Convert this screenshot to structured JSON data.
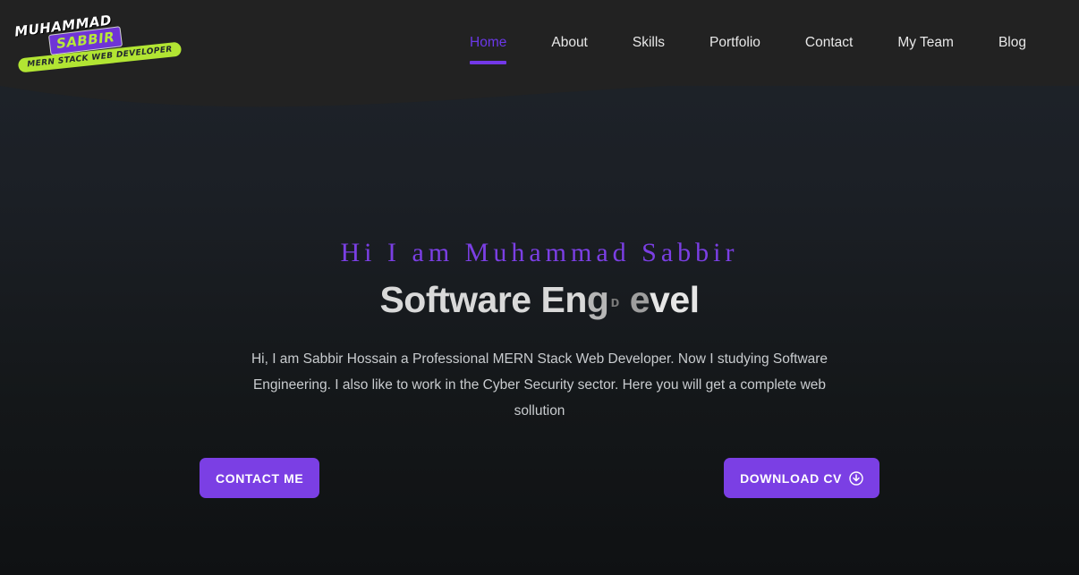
{
  "colors": {
    "accent_purple": "#7b3fe4",
    "nav_active": "#6b38e8",
    "logo_green": "#b2e533",
    "logo_badge_purple": "#6f34d6",
    "header_bg": "#222222",
    "hero_bg_top": "#1f242b",
    "hero_bg_bottom": "#0f1113",
    "body_text": "#c9cccf"
  },
  "logo": {
    "name": "MUHAMMAD",
    "badge": "SABBIR",
    "tagline": "MERN STACK WEB DEVELOPER"
  },
  "nav": {
    "items": [
      {
        "label": "Home",
        "active": true
      },
      {
        "label": "About",
        "active": false
      },
      {
        "label": "Skills",
        "active": false
      },
      {
        "label": "Portfolio",
        "active": false
      },
      {
        "label": "Contact",
        "active": false
      },
      {
        "label": "My Team",
        "active": false
      },
      {
        "label": "Blog",
        "active": false
      }
    ]
  },
  "hero": {
    "greeting": "Hi I am Muhammad Sabbir",
    "typewriter": {
      "full_text": "Software Engineer",
      "visible_segments": [
        {
          "text": "Software En",
          "opacity": "full"
        },
        {
          "text": "g",
          "opacity": "dim"
        },
        {
          "text": "ᴅ",
          "opacity": "faint"
        },
        {
          "text": "e",
          "opacity": "dim"
        },
        {
          "text": "vel",
          "opacity": "full"
        }
      ],
      "rendered": "Software EngD evel"
    },
    "paragraph": "Hi, I am Sabbir Hossain a Professional MERN Stack Web Developer. Now I studying Software Engineering. I also like to work in the Cyber Security sector. Here you will get a complete web sollution",
    "buttons": {
      "contact": {
        "label": "CONTACT ME",
        "icon": null
      },
      "download": {
        "label": "DOWNLOAD CV",
        "icon": "download-circle-icon"
      }
    }
  }
}
